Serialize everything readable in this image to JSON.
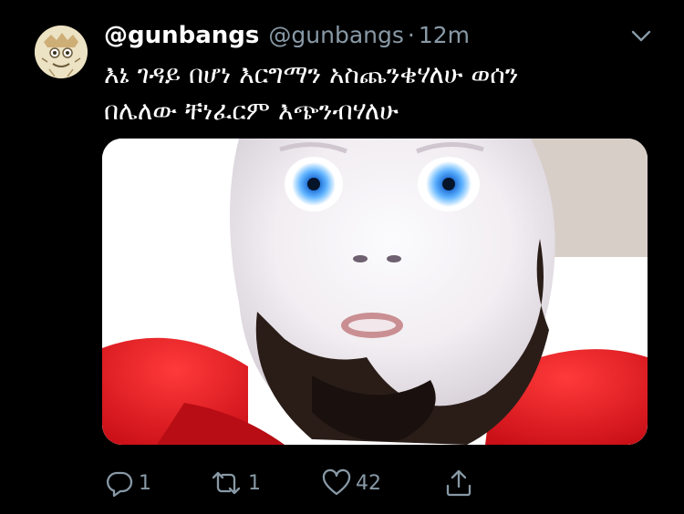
{
  "tweet": {
    "display_name": "@gunbangs",
    "handle": "@gunbangs",
    "separator": "·",
    "time": "12m",
    "text_lines": [
      "እኔ ገዳይ በሆነ እርግማን አስጨንቄሃለሁ ወሰን",
      "በሌለው ቸነፈርም እጭንብሃለሁ"
    ],
    "media": {
      "kind": "photo",
      "description_icon": "photo-face-closeup"
    },
    "actions": {
      "reply": {
        "icon": "reply-icon",
        "count": "1"
      },
      "retweet": {
        "icon": "retweet-icon",
        "count": "1"
      },
      "like": {
        "icon": "heart-icon",
        "count": "42"
      },
      "share": {
        "icon": "share-icon"
      }
    },
    "menu_icon": "chevron-down-icon"
  },
  "colors": {
    "background": "#000000",
    "text_primary": "#ffffff",
    "text_secondary": "#8899a6"
  }
}
